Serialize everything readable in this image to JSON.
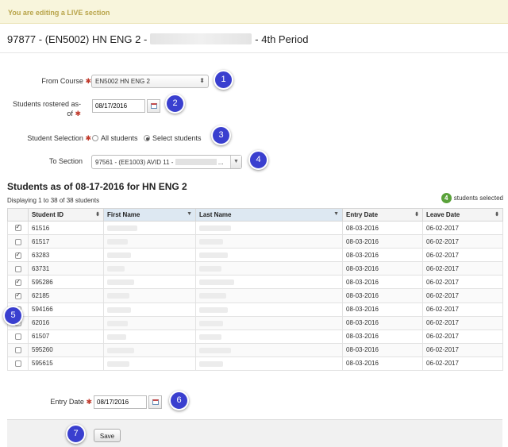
{
  "banner": "You are editing a LIVE section",
  "page_title": {
    "prefix": "97877 - (EN5002) HN ENG 2 -",
    "suffix": "- 4th Period"
  },
  "form": {
    "from_course_label": "From Course",
    "from_course_value": "EN5002 HN ENG 2",
    "rostered_label_line1": "Students rostered as-",
    "rostered_label_line2": "of",
    "rostered_date": "08/17/2016",
    "selection_label": "Student Selection",
    "selection_options": [
      "All students",
      "Select students"
    ],
    "selection_selected": "Select students",
    "to_section_label": "To Section",
    "to_section_value": "97561 - (EE1003) AVID 11 -",
    "to_section_ellipsis": "..."
  },
  "students": {
    "heading": "Students as of 08-17-2016 for HN ENG 2",
    "displaying": "Displaying 1 to 38 of 38 students",
    "selected_count": "4",
    "selected_label": "students selected",
    "columns": [
      "Student ID",
      "First Name",
      "Last Name",
      "Entry Date",
      "Leave Date"
    ],
    "sorted_columns": [
      "First Name",
      "Last Name"
    ],
    "rows": [
      {
        "checked": true,
        "id": "61516",
        "entry": "08-03-2016",
        "leave": "06-02-2017"
      },
      {
        "checked": false,
        "id": "61517",
        "entry": "08-03-2016",
        "leave": "06-02-2017"
      },
      {
        "checked": true,
        "id": "63283",
        "entry": "08-03-2016",
        "leave": "06-02-2017"
      },
      {
        "checked": false,
        "id": "63731",
        "entry": "08-03-2016",
        "leave": "06-02-2017"
      },
      {
        "checked": true,
        "id": "595286",
        "entry": "08-03-2016",
        "leave": "06-02-2017"
      },
      {
        "checked": true,
        "id": "62185",
        "entry": "08-03-2016",
        "leave": "06-02-2017"
      },
      {
        "checked": false,
        "id": "594166",
        "entry": "08-03-2016",
        "leave": "06-02-2017"
      },
      {
        "checked": false,
        "id": "62016",
        "entry": "08-03-2016",
        "leave": "06-02-2017"
      },
      {
        "checked": false,
        "id": "61507",
        "entry": "08-03-2016",
        "leave": "06-02-2017"
      },
      {
        "checked": false,
        "id": "595260",
        "entry": "08-03-2016",
        "leave": "06-02-2017"
      },
      {
        "checked": false,
        "id": "595615",
        "entry": "08-03-2016",
        "leave": "06-02-2017"
      }
    ]
  },
  "entry_date": {
    "label": "Entry Date",
    "value": "08/17/2016"
  },
  "save_label": "Save",
  "badges": [
    "1",
    "2",
    "3",
    "4",
    "5",
    "6",
    "7"
  ],
  "colors": {
    "badge": "#3a3fcf",
    "required": "#c0392b",
    "selected_pill": "#5aa23a",
    "banner_text": "#b8a44a"
  }
}
